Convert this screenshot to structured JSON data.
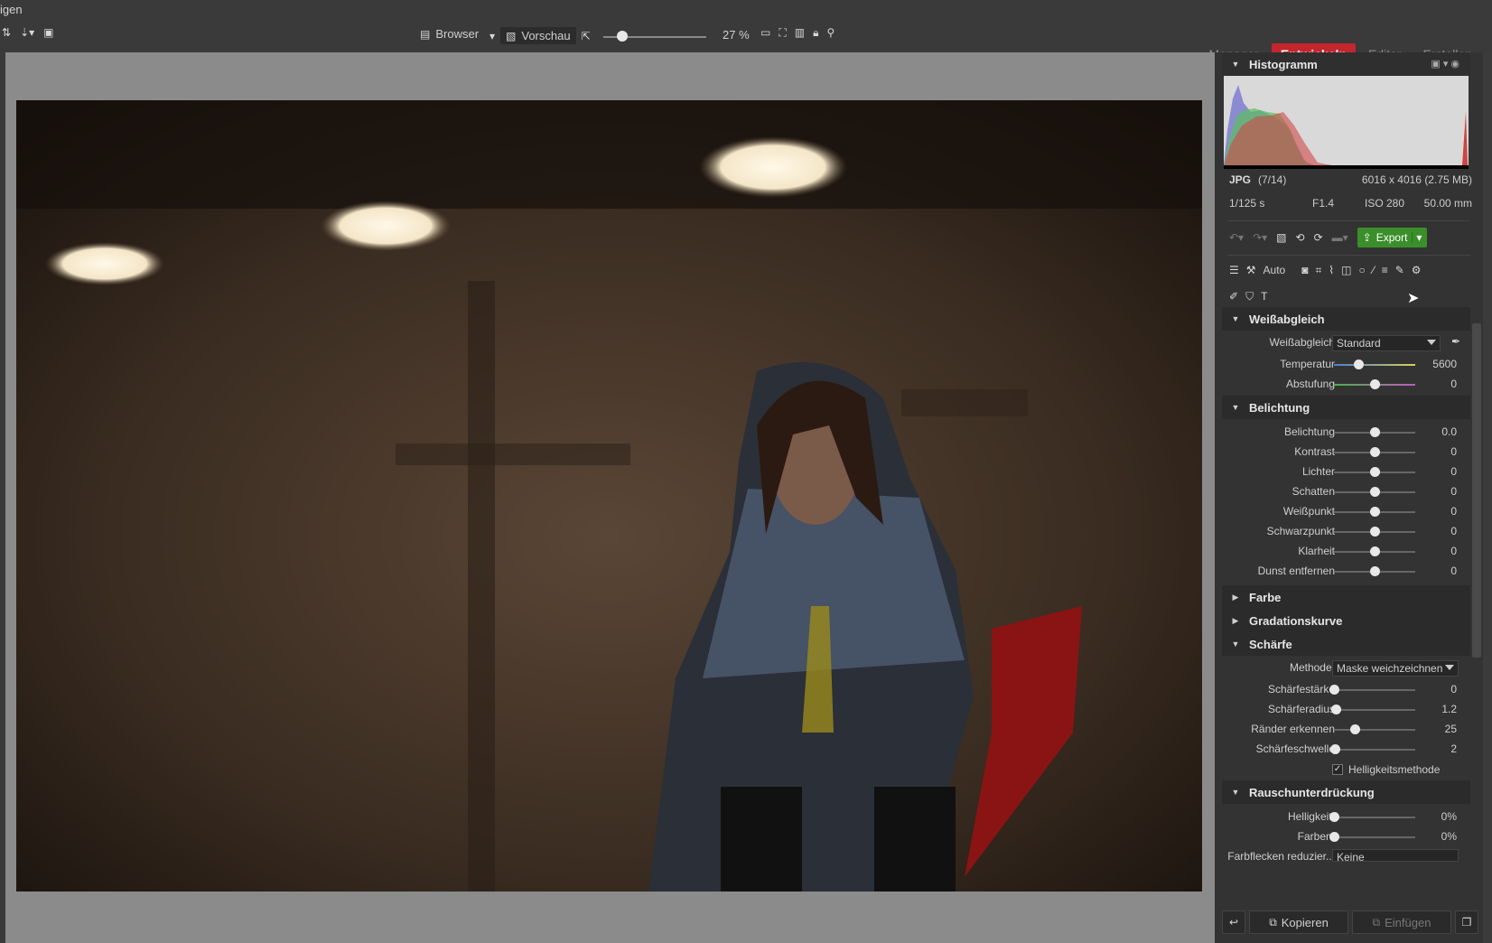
{
  "window": {
    "title": "igen"
  },
  "toolbar": {
    "browser_label": "Browser",
    "preview_label": "Vorschau",
    "zoom_text": "27 %",
    "zoom_level": 0.18
  },
  "modes": [
    {
      "label": "Manager",
      "active": false
    },
    {
      "label": "Entwickeln",
      "active": true
    },
    {
      "label": "Editor",
      "active": false
    },
    {
      "label": "Erstellen",
      "active": false
    }
  ],
  "histogram": {
    "title": "Histogramm",
    "format": "JPG",
    "index": "(7/14)",
    "dimensions": "6016 x 4016 (2.75 MB)",
    "shutter": "1/125 s",
    "aperture": "F1.4",
    "iso": "ISO 280",
    "focal": "50.00 mm"
  },
  "actions": {
    "export_label": "Export",
    "auto_label": "Auto"
  },
  "white_balance": {
    "title": "Weißabgleich",
    "mode_label": "Weißabgleich",
    "mode_value": "Standard",
    "sliders": [
      {
        "label": "Temperatur",
        "value": "5600",
        "pos": 0.3
      },
      {
        "label": "Abstufung",
        "value": "0",
        "pos": 0.5
      }
    ]
  },
  "exposure": {
    "title": "Belichtung",
    "sliders": [
      {
        "label": "Belichtung",
        "value": "0.0",
        "pos": 0.5
      },
      {
        "label": "Kontrast",
        "value": "0",
        "pos": 0.5
      },
      {
        "label": "Lichter",
        "value": "0",
        "pos": 0.5
      },
      {
        "label": "Schatten",
        "value": "0",
        "pos": 0.5
      },
      {
        "label": "Weißpunkt",
        "value": "0",
        "pos": 0.5
      },
      {
        "label": "Schwarzpunkt",
        "value": "0",
        "pos": 0.5
      },
      {
        "label": "Klarheit",
        "value": "0",
        "pos": 0.5
      },
      {
        "label": "Dunst entfernen",
        "value": "0",
        "pos": 0.5
      }
    ]
  },
  "color": {
    "title": "Farbe"
  },
  "curve": {
    "title": "Gradationskurve"
  },
  "sharpen": {
    "title": "Schärfe",
    "method_label": "Methode:",
    "method_value": "Maske weichzeichnen",
    "sliders": [
      {
        "label": "Schärfestärke",
        "value": "0",
        "pos": 0.0
      },
      {
        "label": "Schärferadius",
        "value": "1.2",
        "pos": 0.02
      },
      {
        "label": "Ränder erkennen",
        "value": "25",
        "pos": 0.25
      },
      {
        "label": "Schärfeschwelle",
        "value": "2",
        "pos": 0.01
      }
    ],
    "checkbox_label": "Helligkeitsmethode",
    "checked": true
  },
  "noise": {
    "title": "Rauschunterdrückung",
    "sliders": [
      {
        "label": "Helligkeit:",
        "value": "0%",
        "pos": 0.0
      },
      {
        "label": "Farben:",
        "value": "0%",
        "pos": 0.0
      }
    ],
    "spots_label": "Farbflecken reduzier...",
    "spots_value": "Keine"
  },
  "bottom": {
    "copy_label": "Kopieren",
    "paste_label": "Einfügen"
  },
  "colors": {
    "accent": "#c4262e",
    "export": "#3a8f2a"
  }
}
